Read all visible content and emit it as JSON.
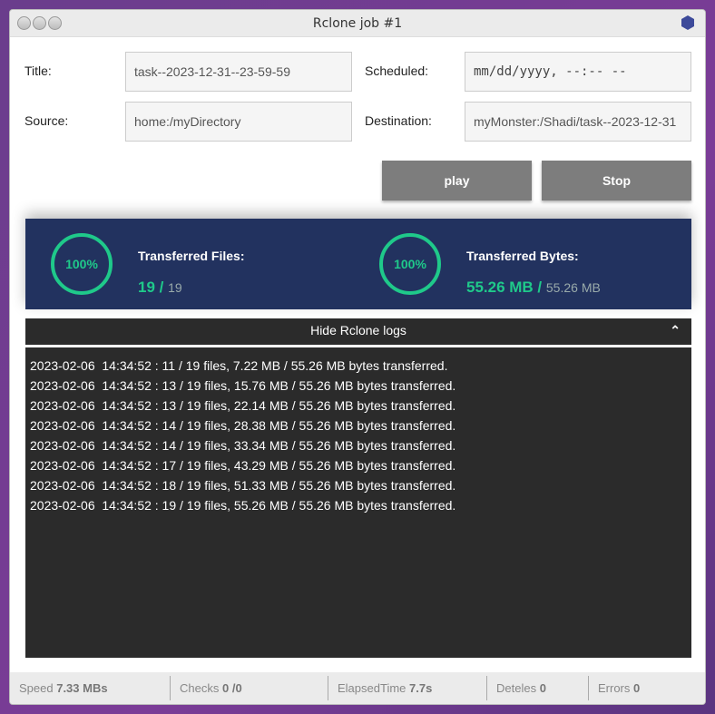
{
  "window": {
    "title": "Rclone job #1"
  },
  "form": {
    "title_label": "Title:",
    "title_value": "task--2023-12-31--23-59-59",
    "scheduled_label": "Scheduled:",
    "scheduled_placeholder": "mm/dd/yyyy, --:-- --",
    "source_label": "Source:",
    "source_value": "home:/myDirectory",
    "destination_label": "Destination:",
    "destination_value": "myMonster:/Shadi/task--2023-12-31"
  },
  "buttons": {
    "play": "play",
    "stop": "Stop"
  },
  "stats": {
    "files_percent": "100%",
    "files_label": "Transferred Files:",
    "files_done": "19 /",
    "files_total": "19",
    "bytes_percent": "100%",
    "bytes_label": "Transferred Bytes:",
    "bytes_done": "55.26 MB /",
    "bytes_total": "55.26 MB"
  },
  "logs": {
    "toggle_label": "Hide Rclone logs",
    "lines": [
      "2023-02-06  14:34:52 : 11 / 19 files, 7.22 MB / 55.26 MB bytes transferred.",
      "2023-02-06  14:34:52 : 13 / 19 files, 15.76 MB / 55.26 MB bytes transferred.",
      "2023-02-06  14:34:52 : 13 / 19 files, 22.14 MB / 55.26 MB bytes transferred.",
      "2023-02-06  14:34:52 : 14 / 19 files, 28.38 MB / 55.26 MB bytes transferred.",
      "2023-02-06  14:34:52 : 14 / 19 files, 33.34 MB / 55.26 MB bytes transferred.",
      "2023-02-06  14:34:52 : 17 / 19 files, 43.29 MB / 55.26 MB bytes transferred.",
      "2023-02-06  14:34:52 : 18 / 19 files, 51.33 MB / 55.26 MB bytes transferred.",
      "2023-02-06  14:34:52 : 19 / 19 files, 55.26 MB / 55.26 MB bytes transferred."
    ]
  },
  "statusbar": [
    {
      "label": "Speed",
      "value": "7.33 MBs"
    },
    {
      "label": "Checks",
      "value": "0 /0"
    },
    {
      "label": "ElapsedTime",
      "value": "7.7s"
    },
    {
      "label": "Deteles",
      "value": "0"
    },
    {
      "label": "Errors",
      "value": "0"
    }
  ]
}
